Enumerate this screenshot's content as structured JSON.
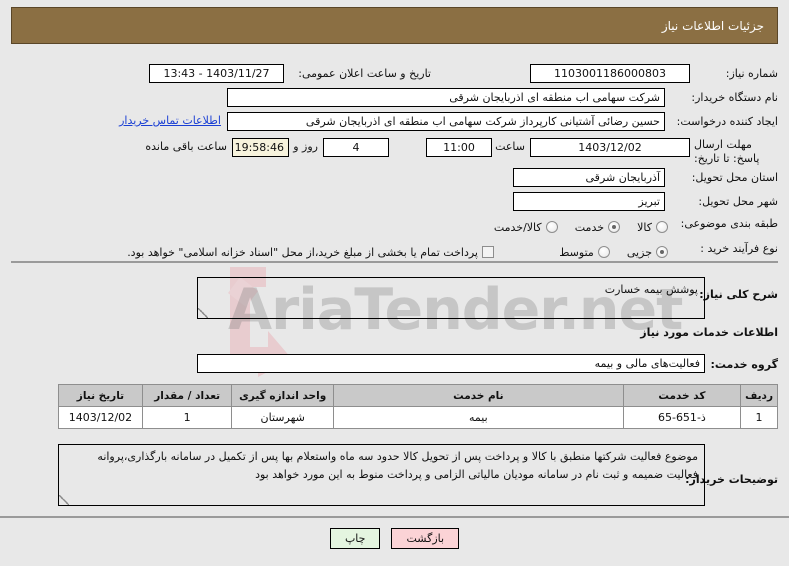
{
  "header": {
    "title": "جزئیات اطلاعات نیاز"
  },
  "form": {
    "need_number_label": "شماره نیاز:",
    "need_number_value": "1103001186000803",
    "announce_label": "تاریخ و ساعت اعلان عمومی:",
    "announce_value": "1403/11/27 - 13:43",
    "buyer_org_label": "نام دستگاه خریدار:",
    "buyer_org_value": "شرکت سهامی اب منطقه ای اذربایجان شرقی",
    "requester_label": "ایجاد کننده درخواست:",
    "requester_value": "حسین رضائی آشتیانی کارپرداز شرکت سهامی اب منطقه ای اذربایجان شرقی",
    "contact_link": "اطلاعات تماس خریدار",
    "deadline_label": "مهلت ارسال پاسخ: تا تاریخ:",
    "deadline_date": "1403/12/02",
    "time_label": "ساعت",
    "deadline_time": "11:00",
    "days_value": "4",
    "days_label": "روز و",
    "countdown_value": "19:58:46",
    "remaining_label": "ساعت باقی مانده",
    "province_label": "استان محل تحویل:",
    "province_value": "آذربایجان شرقی",
    "city_label": "شهر محل تحویل:",
    "city_value": "تبریز",
    "category_label": "طبقه بندی موضوعی:",
    "category_options": [
      {
        "label": "کالا",
        "selected": false
      },
      {
        "label": "خدمت",
        "selected": true
      },
      {
        "label": "کالا/خدمت",
        "selected": false
      }
    ],
    "process_label": "نوع فرآیند خرید :",
    "process_options": [
      {
        "label": "جزیی",
        "selected": true
      },
      {
        "label": "متوسط",
        "selected": false
      }
    ],
    "treasury_checkbox_label": "پرداخت تمام یا بخشی از مبلغ خرید،از محل \"اسناد خزانه اسلامی\" خواهد بود.",
    "treasury_checked": false
  },
  "lower": {
    "summary_label": "شرح کلی نیاز:",
    "summary_value": "پوشش بیمه خسارت",
    "services_section_title": "اطلاعات خدمات مورد نیاز",
    "service_group_label": "گروه خدمت:",
    "service_group_value": "فعالیت‌های مالی و بیمه",
    "buyer_notes_label": "توضیحات خریدار:",
    "buyer_notes_value": "موضوع فعالیت شرکتها منطبق با کالا و پرداخت پس از تحویل کالا حدود سه  ماه واستعلام بها پس از تکمیل در سامانه بارگذاری،پروانه فعالیت ضمیمه و ثبت نام در سامانه مودیان مالیاتی الزامی و پرداخت منوط به این مورد خواهد بود"
  },
  "table": {
    "columns": [
      "ردیف",
      "کد خدمت",
      "نام خدمت",
      "واحد اندازه گیری",
      "تعداد / مقدار",
      "تاریخ نیاز"
    ],
    "rows": [
      {
        "radif": "1",
        "code": "ذ-651-65",
        "name": "بیمه",
        "unit": "شهرستان",
        "quantity": "1",
        "date": "1403/12/02"
      }
    ]
  },
  "footer": {
    "back_label": "بازگشت",
    "print_label": "چاپ"
  },
  "watermark": {
    "text": "AriaTender.net"
  },
  "colors": {
    "header_bg": "#8b6f43",
    "page_bg": "#e8e8e8",
    "link": "#1a3fd4",
    "back_btn": "#fbd3d6",
    "print_btn": "#e4f5e0"
  }
}
